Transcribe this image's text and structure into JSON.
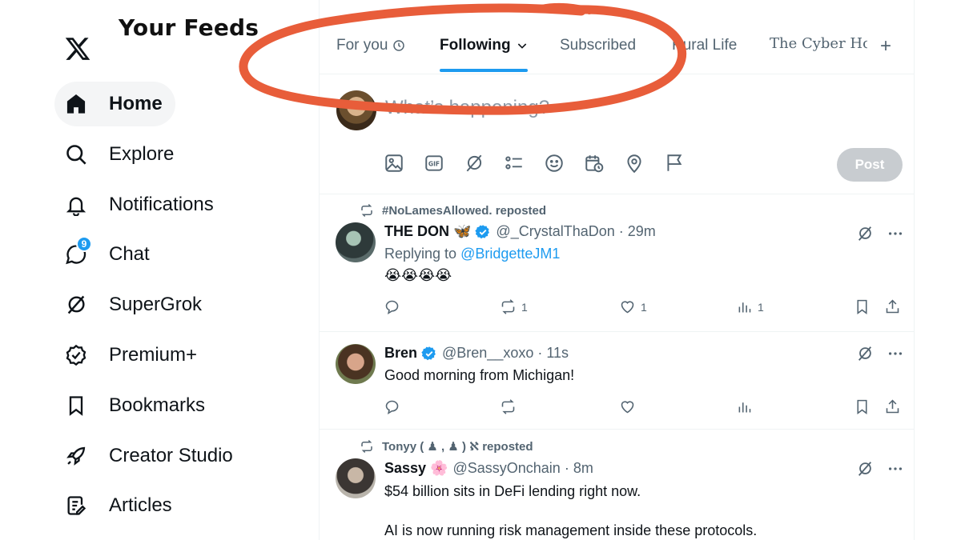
{
  "annotation": {
    "title": "Your Feeds",
    "accent_color": "#e85d3a"
  },
  "brand": {
    "logo_icon": "x-logo-icon"
  },
  "sidebar": {
    "items": [
      {
        "label": "Home",
        "icon": "home-icon",
        "active": true
      },
      {
        "label": "Explore",
        "icon": "search-icon"
      },
      {
        "label": "Notifications",
        "icon": "bell-icon"
      },
      {
        "label": "Chat",
        "icon": "chat-icon",
        "badge": "9"
      },
      {
        "label": "SuperGrok",
        "icon": "grok-icon"
      },
      {
        "label": "Premium+",
        "icon": "premium-icon"
      },
      {
        "label": "Bookmarks",
        "icon": "bookmark-icon"
      },
      {
        "label": "Creator Studio",
        "icon": "rocket-icon"
      },
      {
        "label": "Articles",
        "icon": "article-icon"
      }
    ]
  },
  "tabs": {
    "items": [
      {
        "label": "For you",
        "icon": "clock-icon"
      },
      {
        "label": "Following",
        "icon": "chevron-down-icon",
        "active": true
      },
      {
        "label": "Subscribed"
      },
      {
        "label": "Rural Life"
      },
      {
        "label": "The Cyber Ho"
      }
    ],
    "add_label": "+"
  },
  "composer": {
    "placeholder": "What’s happening?",
    "tools": [
      "image-icon",
      "gif-icon",
      "grok-icon",
      "poll-icon",
      "emoji-icon",
      "schedule-icon",
      "location-icon",
      "flag-icon"
    ],
    "post_label": "Post"
  },
  "posts": [
    {
      "repost": "#NoLamesAllowed. reposted",
      "name": "THE DON",
      "emoji": "🦋",
      "verified": true,
      "handle": "@_CrystalThaDon",
      "time": "· 29m",
      "reply_prefix": "Replying to",
      "reply_to": "@BridgetteJM1",
      "text": "😭😭😭😭",
      "replies": "",
      "reposts": "1",
      "likes": "1",
      "views": "1"
    },
    {
      "name": "Bren",
      "verified": true,
      "handle": "@Bren__xoxo",
      "time": "· 11s",
      "text": "Good morning from Michigan!",
      "replies": "",
      "reposts": "",
      "likes": "",
      "views": ""
    },
    {
      "repost": "Tonyy ( ♟ , ♟ ) ℵ reposted",
      "name": "Sassy",
      "emoji": "🌸",
      "handle": "@SassyOnchain",
      "time": "· 8m",
      "text": "$54 billion sits in DeFi lending right now.",
      "text2": "AI is now running risk management inside these protocols."
    }
  ]
}
